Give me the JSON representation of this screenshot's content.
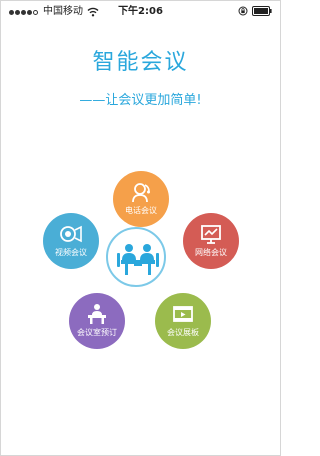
{
  "status_bar": {
    "carrier": "中国移动",
    "time": "下午2:06",
    "signal_level": 4,
    "signal_max": 5
  },
  "header": {
    "title": "智能会议",
    "tagline": "——让会议更加简单!"
  },
  "features": {
    "phone": {
      "label": "电话会议",
      "icon": "phone-headset-icon",
      "color": "#f5a04a"
    },
    "video": {
      "label": "视频会议",
      "icon": "video-camera-icon",
      "color": "#4aaed6"
    },
    "network": {
      "label": "网络会议",
      "icon": "presentation-screen-icon",
      "color": "#d45c55"
    },
    "booking": {
      "label": "会议室预订",
      "icon": "meeting-room-icon",
      "color": "#8c6bbf"
    },
    "showcase": {
      "label": "会议展板",
      "icon": "film-play-icon",
      "color": "#9bbb4d"
    }
  },
  "hub": {
    "icon": "conference-table-icon",
    "color": "#2aa7dc"
  }
}
